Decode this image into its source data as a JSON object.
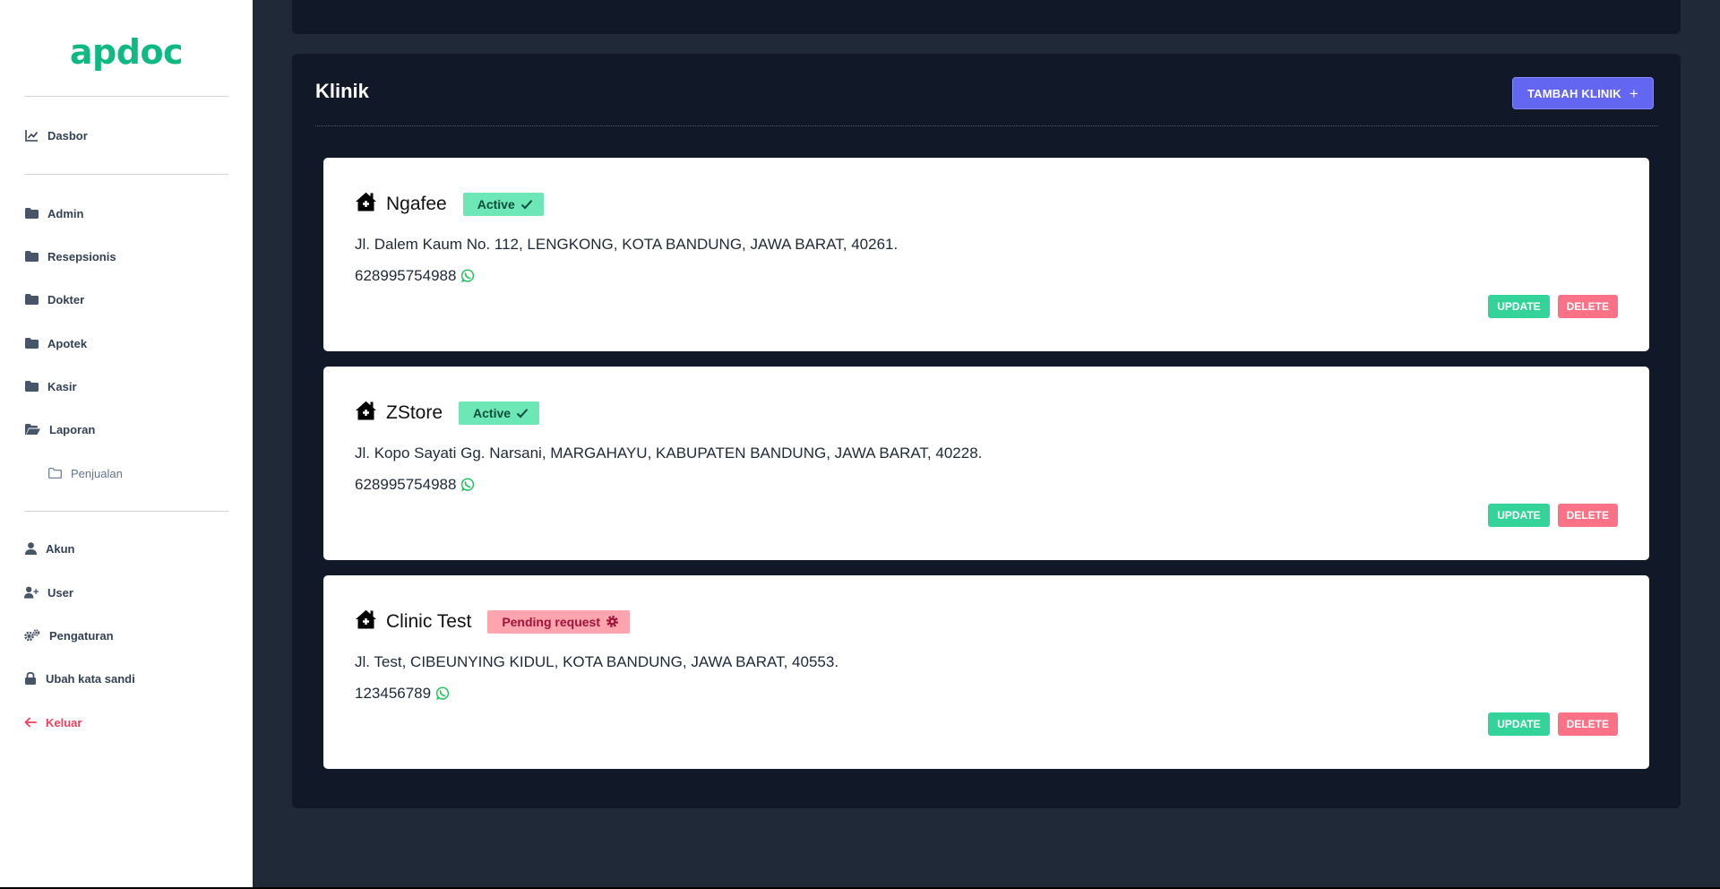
{
  "app": {
    "logo": "apdoc"
  },
  "sidebar": {
    "items": [
      {
        "label": "Dasbor",
        "icon": "chart-line-icon"
      },
      {
        "label": "Admin",
        "icon": "folder-icon"
      },
      {
        "label": "Resepsionis",
        "icon": "folder-icon"
      },
      {
        "label": "Dokter",
        "icon": "folder-icon"
      },
      {
        "label": "Apotek",
        "icon": "folder-icon"
      },
      {
        "label": "Kasir",
        "icon": "folder-icon"
      },
      {
        "label": "Laporan",
        "icon": "folder-open-icon"
      },
      {
        "label": "Penjualan",
        "icon": "folder-outline-icon"
      },
      {
        "label": "Akun",
        "icon": "user-icon"
      },
      {
        "label": "User",
        "icon": "user-plus-icon"
      },
      {
        "label": "Pengaturan",
        "icon": "gears-icon"
      },
      {
        "label": "Ubah kata sandi",
        "icon": "lock-icon"
      },
      {
        "label": "Keluar",
        "icon": "arrow-left-icon"
      }
    ]
  },
  "panel": {
    "title": "Klinik",
    "add_button": "TAMBAH KLINIK",
    "add_button_icon": "plus-icon"
  },
  "clinics": [
    {
      "name": "Ngafee",
      "status": "Active",
      "status_icon": "check-icon",
      "address": "Jl. Dalem Kaum No. 112, LENGKONG, KOTA BANDUNG, JAWA BARAT, 40261.",
      "phone": "628995754988",
      "update": "UPDATE",
      "delete": "DELETE"
    },
    {
      "name": "ZStore",
      "status": "Active",
      "status_icon": "check-icon",
      "address": "Jl. Kopo Sayati Gg. Narsani, MARGAHAYU, KABUPATEN BANDUNG, JAWA BARAT, 40228.",
      "phone": "628995754988",
      "update": "UPDATE",
      "delete": "DELETE"
    },
    {
      "name": "Clinic Test",
      "status": "Pending request",
      "status_icon": "gear-icon",
      "address": "Jl. Test, CIBEUNYING KIDUL, KOTA BANDUNG, JAWA BARAT, 40553.",
      "phone": "123456789",
      "update": "UPDATE",
      "delete": "DELETE"
    }
  ],
  "colors": {
    "brand": "#10b981",
    "sidebar_bg": "#ffffff",
    "main_bg": "#1f2937",
    "panel_bg": "#111827",
    "primary_button": "#6366f1",
    "update_button": "#34d399",
    "delete_button": "#fb7185",
    "active_badge": "#6ee7b7",
    "pending_badge": "#fda4af",
    "logout": "#f43f5e"
  }
}
